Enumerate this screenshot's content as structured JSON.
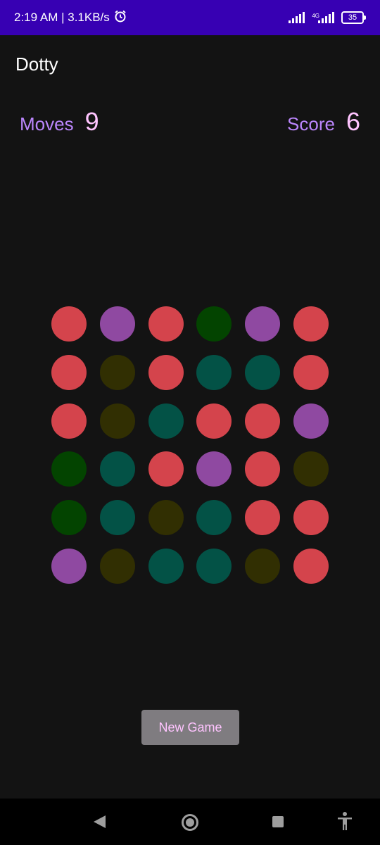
{
  "status_bar": {
    "time_speed": "2:19 AM | 3.1KB/s",
    "network_label": "4G",
    "battery": "35",
    "icons": [
      "alarm-icon",
      "signal-icon",
      "signal-4g-icon",
      "battery-icon"
    ]
  },
  "app": {
    "title": "Dotty"
  },
  "stats": {
    "moves_label": "Moves",
    "moves_value": "9",
    "score_label": "Score",
    "score_value": "6"
  },
  "colors": {
    "red": "#D4444C",
    "purple": "#8F49A1",
    "green": "#034400",
    "teal": "#035246",
    "olive": "#312F02"
  },
  "grid": [
    [
      "red",
      "purple",
      "red",
      "green",
      "purple",
      "red"
    ],
    [
      "red",
      "olive",
      "red",
      "teal",
      "teal",
      "red"
    ],
    [
      "red",
      "olive",
      "teal",
      "red",
      "red",
      "purple"
    ],
    [
      "green",
      "teal",
      "red",
      "purple",
      "red",
      "olive"
    ],
    [
      "green",
      "teal",
      "olive",
      "teal",
      "red",
      "red"
    ],
    [
      "purple",
      "olive",
      "teal",
      "teal",
      "olive",
      "red"
    ]
  ],
  "new_game_label": "New Game",
  "nav": {
    "icons": [
      "back-icon",
      "home-icon",
      "recents-icon",
      "accessibility-icon"
    ]
  }
}
